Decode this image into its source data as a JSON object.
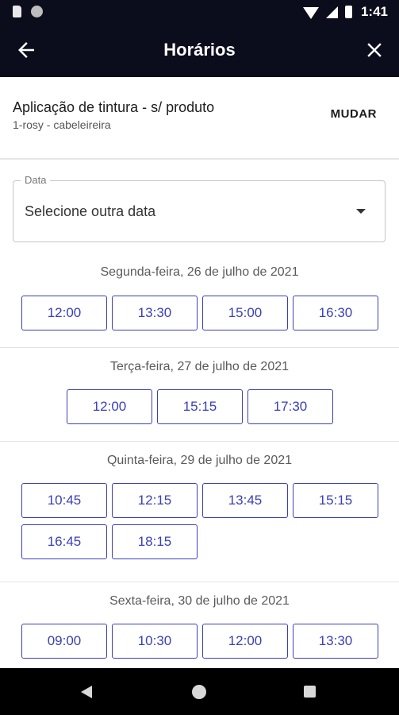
{
  "status_bar": {
    "time": "1:41",
    "icons": [
      "sd-card-icon",
      "notification-dot-icon",
      "wifi-icon",
      "signal-icon",
      "battery-icon"
    ]
  },
  "app_bar": {
    "title": "Horários",
    "back_icon": "back-arrow-icon",
    "close_icon": "close-icon"
  },
  "service": {
    "name": "Aplicação de tintura - s/ produto",
    "professional": "1-rosy - cabeleireira",
    "change_label": "MUDAR"
  },
  "date_picker": {
    "label": "Data",
    "value": "Selecione outra data",
    "icon": "dropdown-arrow-icon"
  },
  "days": [
    {
      "label": "Segunda-feira, 26 de julho de 2021",
      "slots": [
        "12:00",
        "13:30",
        "15:00",
        "16:30"
      ]
    },
    {
      "label": "Terça-feira, 27 de julho de 2021",
      "slots": [
        "12:00",
        "15:15",
        "17:30"
      ]
    },
    {
      "label": "Quinta-feira, 29 de julho de 2021",
      "slots": [
        "10:45",
        "12:15",
        "13:45",
        "15:15",
        "16:45",
        "18:15"
      ]
    },
    {
      "label": "Sexta-feira, 30 de julho de 2021",
      "slots": [
        "09:00",
        "10:30",
        "12:00",
        "13:30"
      ]
    }
  ],
  "colors": {
    "app_bar": "#0b0c1c",
    "accent": "#3a40b8"
  }
}
